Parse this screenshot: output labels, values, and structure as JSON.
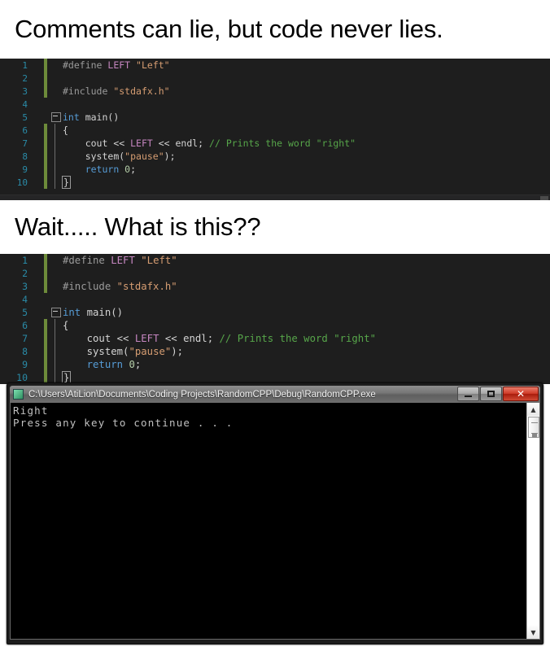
{
  "meme": {
    "caption_1": "Comments can lie, but code never lies.",
    "caption_2": "Wait..... What is this??"
  },
  "code": {
    "lines": [
      {
        "num": "1",
        "changed": true,
        "fold": "none"
      },
      {
        "num": "2",
        "changed": true,
        "fold": "none"
      },
      {
        "num": "3",
        "changed": true,
        "fold": "none"
      },
      {
        "num": "4",
        "changed": false,
        "fold": "none"
      },
      {
        "num": "5",
        "changed": false,
        "fold": "box"
      },
      {
        "num": "6",
        "changed": true,
        "fold": "line"
      },
      {
        "num": "7",
        "changed": true,
        "fold": "line"
      },
      {
        "num": "8",
        "changed": true,
        "fold": "line"
      },
      {
        "num": "9",
        "changed": true,
        "fold": "line"
      },
      {
        "num": "10",
        "changed": true,
        "fold": "line"
      }
    ],
    "line_1_define": "#define",
    "line_1_macro": "LEFT",
    "line_1_string": "\"Left\"",
    "line_3_include": "#include",
    "line_3_string": "\"stdafx.h\"",
    "line_5_kw": "int",
    "line_5_fn": " main()",
    "line_6_brace": "{",
    "line_7_cout": "cout << ",
    "line_7_macro": "LEFT",
    "line_7_endl": " << endl;",
    "line_7_comment": "// Prints the word \"right\"",
    "line_8_call": "system(",
    "line_8_string": "\"pause\"",
    "line_8_tail": ");",
    "line_9_kw": "return",
    "line_9_num": " 0",
    "line_9_semi": ";",
    "line_10_brace": "}"
  },
  "console": {
    "title": "C:\\Users\\AtiLion\\Documents\\Coding Projects\\RandomCPP\\Debug\\RandomCPP.exe",
    "output_line_1": "Right",
    "output_line_2": "Press any key to continue . . .",
    "minimize_label": "Minimize",
    "maximize_label": "Maximize",
    "close_glyph": "✕",
    "scroll_up_glyph": "▲",
    "scroll_down_glyph": "▼"
  },
  "colors": {
    "editor_bg": "#1e1e1e",
    "line_number": "#2b91af",
    "change_bar": "#6d8b3a",
    "macro": "#c586c0",
    "string": "#d69d72",
    "keyword": "#569cd6",
    "comment": "#57a64a",
    "preprocessor": "#9b9b9b",
    "close_button": "#cf3b28"
  }
}
